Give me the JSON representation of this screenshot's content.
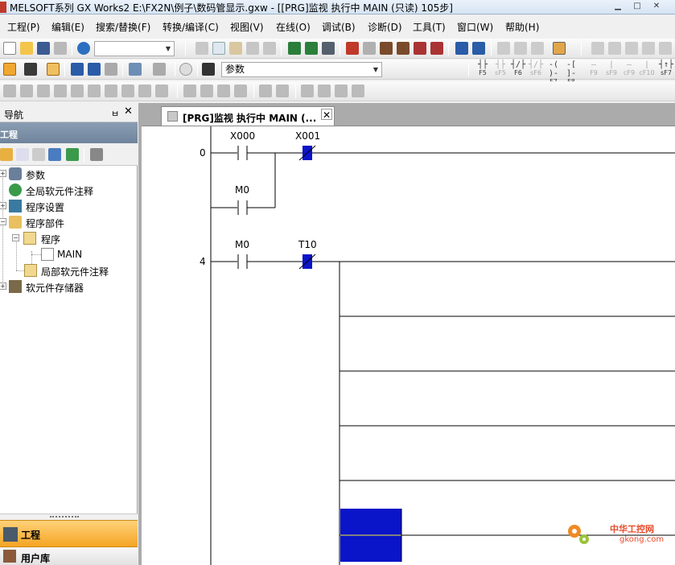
{
  "window": {
    "title": "MELSOFT系列 GX Works2 E:\\FX2N\\例子\\数码管显示.gxw - [[PRG]监视 执行中 MAIN (只读) 105步]"
  },
  "menu": [
    "工程(P)",
    "编辑(E)",
    "搜索/替换(F)",
    "转换/编译(C)",
    "视图(V)",
    "在线(O)",
    "调试(B)",
    "诊断(D)",
    "工具(T)",
    "窗口(W)",
    "帮助(H)"
  ],
  "toolbar": {
    "combo1_value": "",
    "combo2_value": "参数"
  },
  "fkeys": [
    {
      "sym": "┤├",
      "key": "F5"
    },
    {
      "sym": "┤├",
      "key": "sF5"
    },
    {
      "sym": "┤/├",
      "key": "F6"
    },
    {
      "sym": "┤/├",
      "key": "sF6"
    },
    {
      "sym": "-( )-",
      "key": "F7"
    },
    {
      "sym": "-[ ]-",
      "key": "F8"
    },
    {
      "sym": "—",
      "key": "F9"
    },
    {
      "sym": "|",
      "key": "sF9"
    },
    {
      "sym": "—",
      "key": "cF9"
    },
    {
      "sym": "|",
      "key": "cF10"
    },
    {
      "sym": "┤↑├",
      "key": "sF7"
    }
  ],
  "navigation": {
    "header": "导航",
    "pin": "ㅂ",
    "close": "✕",
    "section_title": "工程",
    "tree": [
      {
        "label": "参数"
      },
      {
        "label": "全局软元件注释"
      },
      {
        "label": "程序设置"
      },
      {
        "label": "程序部件"
      },
      {
        "label": "程序"
      },
      {
        "label": "MAIN"
      },
      {
        "label": "局部软元件注释"
      },
      {
        "label": "软元件存储器"
      }
    ],
    "bottom_tabs": [
      {
        "label": "工程"
      },
      {
        "label": "用户库"
      }
    ]
  },
  "document_tab": {
    "label": "[PRG]监视 执行中 MAIN (...",
    "close": "✕"
  },
  "ladder": {
    "rungs": [
      {
        "step": "0",
        "contacts": [
          {
            "label": "X000",
            "type": "NO",
            "on": false
          },
          {
            "label": "X001",
            "type": "NC",
            "on": true
          }
        ],
        "branch": [
          {
            "label": "M0",
            "type": "NO",
            "on": false
          }
        ]
      },
      {
        "step": "4",
        "contacts": [
          {
            "label": "M0",
            "type": "NO",
            "on": false
          },
          {
            "label": "T10",
            "type": "NC",
            "on": true
          }
        ]
      }
    ]
  },
  "colors": {
    "monitor_on": "#0a14c8",
    "nav_active": "#f5a524",
    "watermark": "#e94b2c"
  },
  "watermark": {
    "cn": "中华工控网",
    "url": "gkong.com"
  }
}
